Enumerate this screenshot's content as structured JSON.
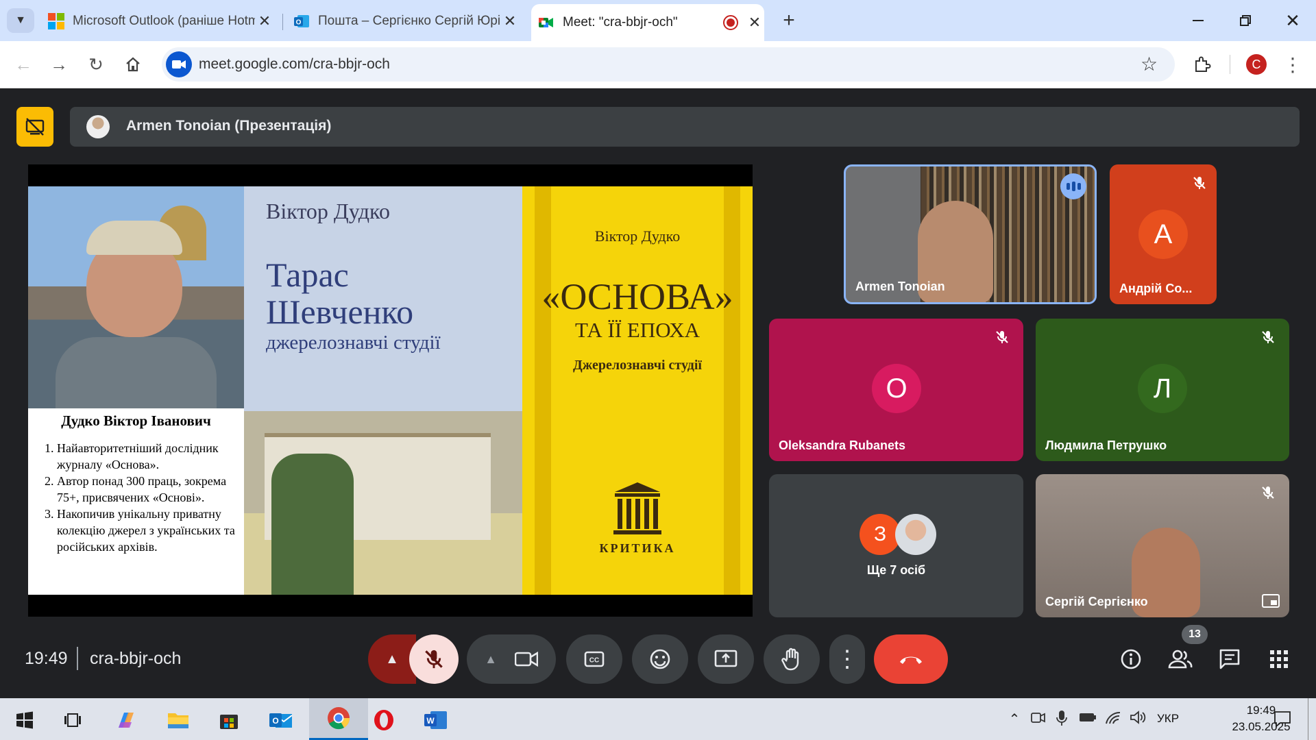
{
  "browser": {
    "tabs": [
      {
        "title": "Microsoft Outlook (раніше Hotmail)",
        "icon": "windows-logo-icon"
      },
      {
        "title": "Пошта – Сергієнко Сергій Юрійович",
        "icon": "outlook-icon"
      },
      {
        "title": "Meet: \"cra-bbjr-och\"",
        "icon": "meet-icon"
      }
    ],
    "url": "meet.google.com/cra-bbjr-och",
    "profile_initial": "С"
  },
  "meet": {
    "presenter_banner": "Armen Tonoian (Презентація)",
    "slide": {
      "bio_title": "Дудко Віктор Іванович",
      "bio_items": [
        "Найавторитетніший дослідник журналу «Основа».",
        "Автор понад 300 праць, зокрема 75+, присвячених «Основі».",
        "Накопичив унікальну приватну колекцію джерел з українських та російських архівів."
      ],
      "book1": {
        "author": "Віктор Дудко",
        "title_line1": "Тарас",
        "title_line2": "Шевченко",
        "subtitle": "джерелознавчі студії"
      },
      "book2": {
        "author": "Віктор Дудко",
        "title": "«ОСНОВА»",
        "title2": "ТА ЇЇ ЕПОХА",
        "subtitle": "Джерелознавчі студії",
        "publisher": "КРИТИКА"
      }
    },
    "participants": [
      {
        "name": "Armen Tonoian",
        "type": "video",
        "speaking": true
      },
      {
        "name": "Андрій Со...",
        "initial": "А",
        "color": "#e8501e",
        "muted": true
      },
      {
        "name": "Oleksandra Rubanets",
        "initial": "О",
        "color": "#d81b60",
        "muted": true
      },
      {
        "name": "Людмила Петрушко",
        "initial": "Л",
        "color": "#33691e",
        "muted": true
      },
      {
        "others_label": "Ще 7 осіб",
        "initial": "З",
        "color": "#f4511e"
      },
      {
        "name": "Сергій Сергієнко",
        "type": "video",
        "muted": true
      }
    ],
    "time": "19:49",
    "meeting_code": "cra-bbjr-och",
    "people_count": "13"
  },
  "taskbar": {
    "language": "УКР",
    "time": "19:49",
    "date": "23.05.2025"
  }
}
